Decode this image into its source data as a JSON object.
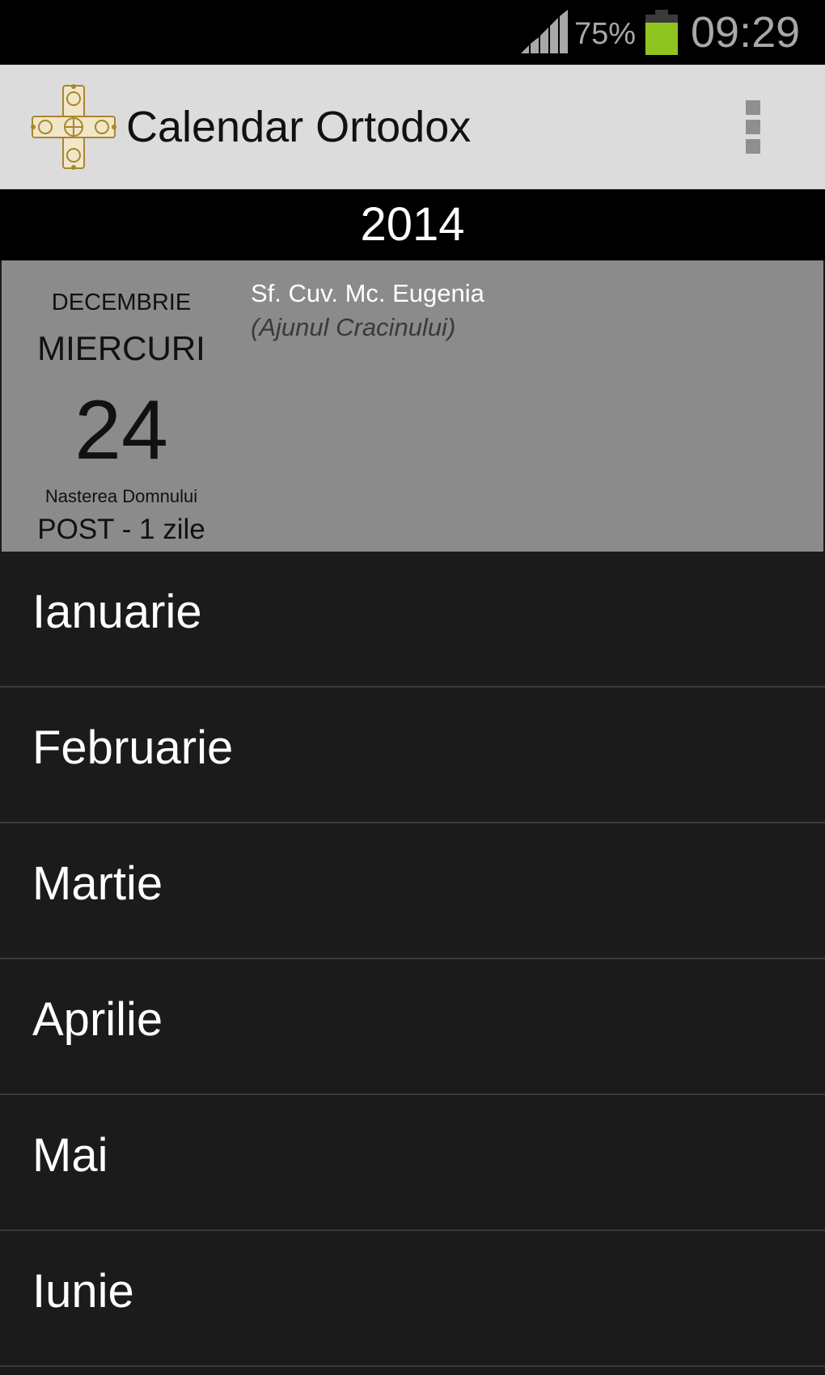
{
  "status_bar": {
    "battery_percent": "75%",
    "time": "09:29",
    "signal_icon": "signal-icon",
    "battery_icon": "battery-icon",
    "battery_color": "#8fc31f"
  },
  "action_bar": {
    "title": "Calendar Ortodox",
    "logo_icon": "orthodox-cross-icon",
    "menu_icon": "overflow-menu-icon",
    "background": "#dcdcdc"
  },
  "year": "2014",
  "today": {
    "month": "DECEMBRIE",
    "weekday": "MIERCURI",
    "day": "24",
    "fast_name": "Nasterea Domnului",
    "fast_days": "POST - 1 zile",
    "saint": "Sf. Cuv. Mc. Eugenia",
    "feast_note": "(Ajunul Cracinului)"
  },
  "months": [
    {
      "label": "Ianuarie"
    },
    {
      "label": "Februarie"
    },
    {
      "label": "Martie"
    },
    {
      "label": "Aprilie"
    },
    {
      "label": "Mai"
    },
    {
      "label": "Iunie"
    }
  ]
}
